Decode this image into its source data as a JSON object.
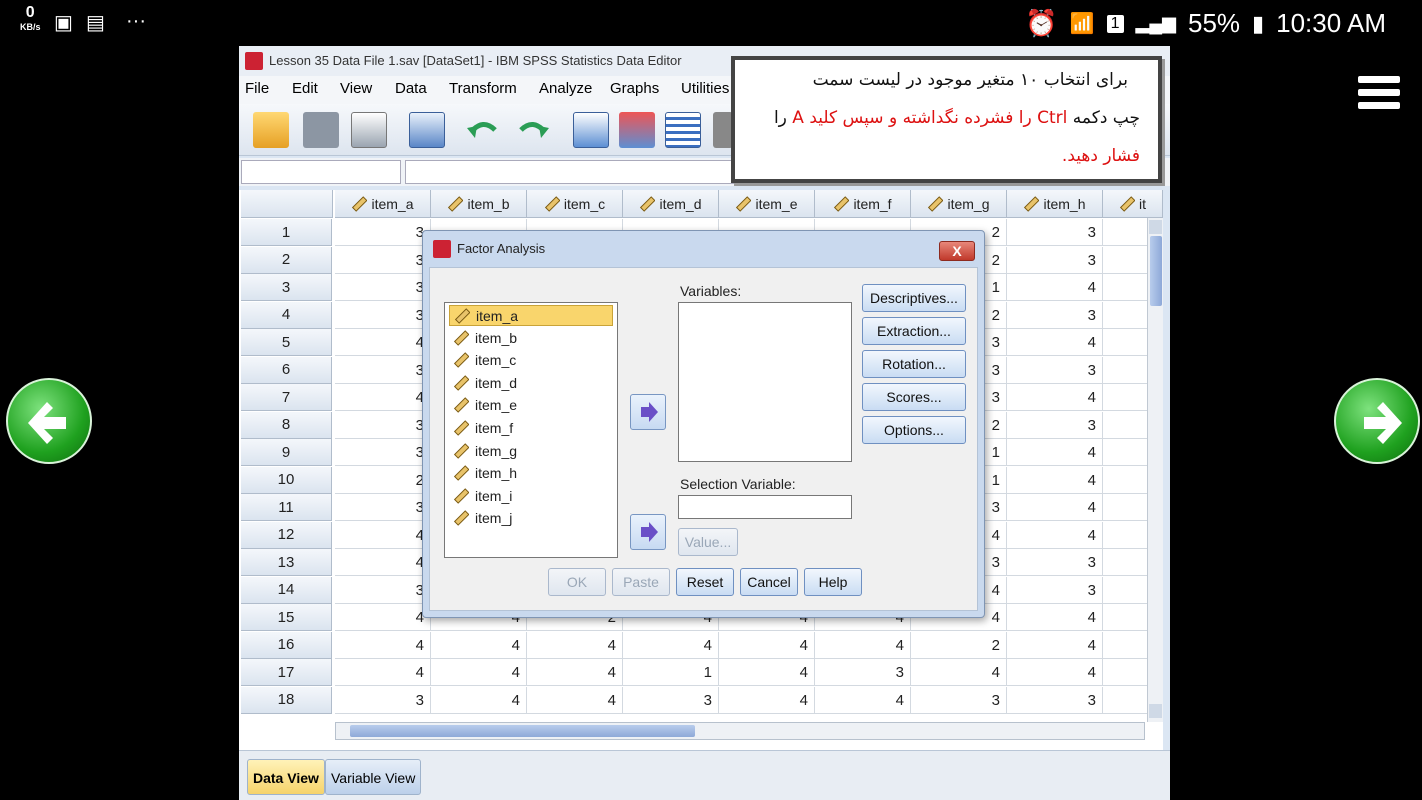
{
  "statusbar": {
    "data_rate": "0",
    "data_unit": "KB/s",
    "battery": "55%",
    "time": "10:30 AM",
    "sim": "1"
  },
  "window": {
    "title": "Lesson 35 Data File 1.sav [DataSet1] - IBM SPSS Statistics Data Editor"
  },
  "menu": [
    "File",
    "Edit",
    "View",
    "Data",
    "Transform",
    "Analyze",
    "Graphs",
    "Utilities"
  ],
  "columns": [
    "item_a",
    "item_b",
    "item_c",
    "item_d",
    "item_e",
    "item_f",
    "item_g",
    "item_h",
    "it"
  ],
  "rows": [
    {
      "n": "1",
      "cells": [
        "3",
        "",
        "",
        "",
        "",
        "",
        "2",
        "3"
      ]
    },
    {
      "n": "2",
      "cells": [
        "3",
        "",
        "",
        "",
        "",
        "",
        "2",
        "3"
      ]
    },
    {
      "n": "3",
      "cells": [
        "3",
        "",
        "",
        "",
        "",
        "",
        "1",
        "4"
      ]
    },
    {
      "n": "4",
      "cells": [
        "3",
        "",
        "",
        "",
        "",
        "",
        "2",
        "3"
      ]
    },
    {
      "n": "5",
      "cells": [
        "4",
        "",
        "",
        "",
        "",
        "",
        "3",
        "4"
      ]
    },
    {
      "n": "6",
      "cells": [
        "3",
        "",
        "",
        "",
        "",
        "",
        "3",
        "3"
      ]
    },
    {
      "n": "7",
      "cells": [
        "4",
        "",
        "",
        "",
        "",
        "",
        "3",
        "4"
      ]
    },
    {
      "n": "8",
      "cells": [
        "3",
        "",
        "",
        "",
        "",
        "",
        "2",
        "3"
      ]
    },
    {
      "n": "9",
      "cells": [
        "3",
        "",
        "",
        "",
        "",
        "",
        "1",
        "4"
      ]
    },
    {
      "n": "10",
      "cells": [
        "2",
        "",
        "",
        "",
        "",
        "",
        "1",
        "4"
      ]
    },
    {
      "n": "11",
      "cells": [
        "3",
        "",
        "",
        "",
        "",
        "",
        "3",
        "4"
      ]
    },
    {
      "n": "12",
      "cells": [
        "4",
        "",
        "",
        "",
        "",
        "",
        "4",
        "4"
      ]
    },
    {
      "n": "13",
      "cells": [
        "4",
        "",
        "",
        "",
        "",
        "",
        "3",
        "3"
      ]
    },
    {
      "n": "14",
      "cells": [
        "3",
        "",
        "",
        "",
        "",
        "",
        "4",
        "3"
      ]
    },
    {
      "n": "15",
      "cells": [
        "4",
        "4",
        "2",
        "4",
        "4",
        "4",
        "4",
        "4"
      ]
    },
    {
      "n": "16",
      "cells": [
        "4",
        "4",
        "4",
        "4",
        "4",
        "4",
        "2",
        "4"
      ]
    },
    {
      "n": "17",
      "cells": [
        "4",
        "4",
        "4",
        "1",
        "4",
        "3",
        "4",
        "4"
      ]
    },
    {
      "n": "18",
      "cells": [
        "3",
        "4",
        "4",
        "3",
        "4",
        "4",
        "3",
        "3"
      ]
    }
  ],
  "tabs": {
    "data_view": "Data View",
    "variable_view": "Variable View"
  },
  "dialog": {
    "title": "Factor Analysis",
    "close": "X",
    "source_vars": [
      "item_a",
      "item_b",
      "item_c",
      "item_d",
      "item_e",
      "item_f",
      "item_g",
      "item_h",
      "item_i",
      "item_j"
    ],
    "variables_label": "Variables:",
    "selection_label": "Selection Variable:",
    "value_btn": "Value...",
    "side_buttons": [
      "Descriptives...",
      "Extraction...",
      "Rotation...",
      "Scores...",
      "Options..."
    ],
    "bottom_buttons": {
      "ok": "OK",
      "paste": "Paste",
      "reset": "Reset",
      "cancel": "Cancel",
      "help": "Help"
    }
  },
  "note": {
    "line1": "برای انتخاب ۱۰ متغیر موجود در لیست سمت",
    "line2_a": "چپ دکمه ",
    "line2_ctrl": "Ctrl",
    "line2_b": " را فشرده نگداشته و سپس کلید ",
    "line2_key": "A",
    "line2_c": " را",
    "line3": "فشار دهید."
  }
}
